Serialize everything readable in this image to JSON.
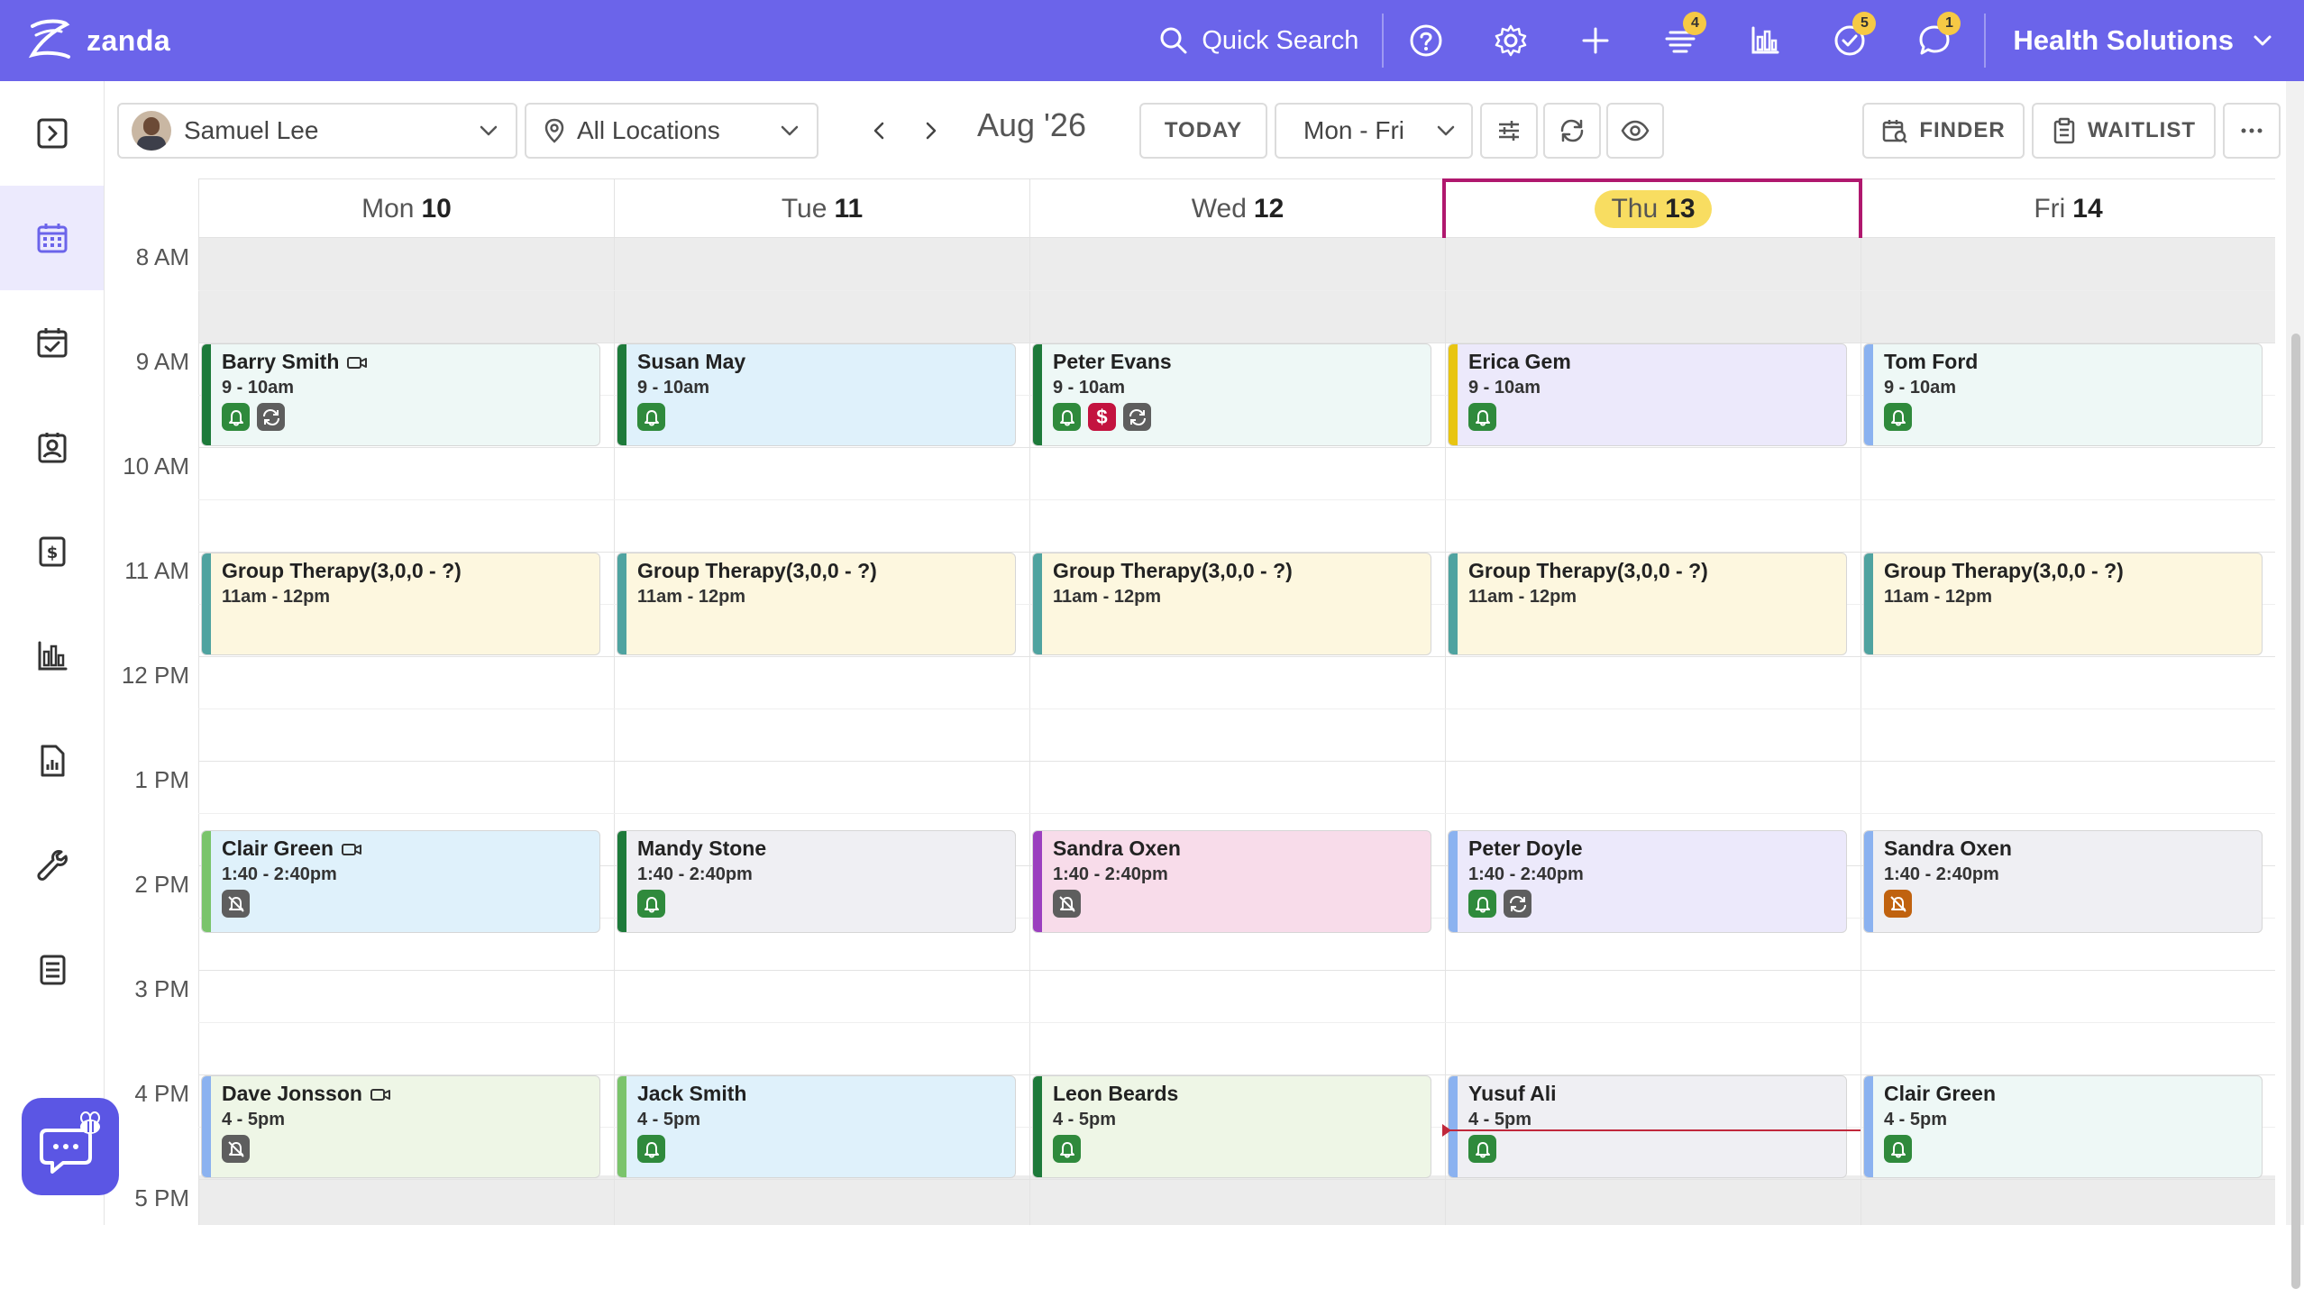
{
  "app": {
    "brand": "zanda",
    "quick_search": "Quick Search",
    "org": "Health Solutions",
    "badges": {
      "tasks": "4",
      "todo": "5",
      "messages": "1"
    }
  },
  "toolbar": {
    "practitioner": "Samuel Lee",
    "location": "All Locations",
    "month": "Aug '26",
    "today": "TODAY",
    "view": "Mon - Fri",
    "finder": "FINDER",
    "waitlist": "WAITLIST"
  },
  "days": [
    {
      "dow": "Mon",
      "num": "10"
    },
    {
      "dow": "Tue",
      "num": "11"
    },
    {
      "dow": "Wed",
      "num": "12"
    },
    {
      "dow": "Thu",
      "num": "13"
    },
    {
      "dow": "Fri",
      "num": "14"
    }
  ],
  "times": [
    "8 AM",
    "9 AM",
    "10 AM",
    "11 AM",
    "12 PM",
    "1 PM",
    "2 PM",
    "3 PM",
    "4 PM",
    "5 PM"
  ],
  "colors": {
    "brand": "#6b64ea",
    "green": "#2f8a3c",
    "teal": "#4fa3a0",
    "yellow": "#e8c511",
    "light_blue": "#8bb2f0",
    "purple": "#9b3fbf",
    "light_green": "#7ac46b",
    "dark_green": "#1d7a3a",
    "now": "#c0283b"
  },
  "appointments": [
    {
      "day": 0,
      "slot": "9",
      "name": "Barry Smith",
      "time": "9 - 10am",
      "video": true,
      "icons": [
        "bell",
        "repeat"
      ],
      "bg": "#eef8f6",
      "bar": "#1d7a3a"
    },
    {
      "day": 1,
      "slot": "9",
      "name": "Susan May",
      "time": "9 - 10am",
      "video": false,
      "icons": [
        "bell"
      ],
      "bg": "#dff1fb",
      "bar": "#1d7a3a"
    },
    {
      "day": 2,
      "slot": "9",
      "name": "Peter Evans",
      "time": "9 - 10am",
      "video": false,
      "icons": [
        "bell",
        "dollar",
        "repeat"
      ],
      "bg": "#eef8f6",
      "bar": "#1d7a3a"
    },
    {
      "day": 3,
      "slot": "9",
      "name": "Erica Gem",
      "time": "9 - 10am",
      "video": false,
      "icons": [
        "bell"
      ],
      "bg": "#ece9fb",
      "bar": "#e8c511"
    },
    {
      "day": 4,
      "slot": "9",
      "name": "Tom Ford",
      "time": "9 - 10am",
      "video": false,
      "icons": [
        "bell"
      ],
      "bg": "#eef8f6",
      "bar": "#8bb2f0"
    },
    {
      "day": 0,
      "slot": "11",
      "name": "Group Therapy(3,0,0 - ?)",
      "time": "11am - 12pm",
      "video": false,
      "icons": [],
      "bg": "#fdf7df",
      "bar": "#4fa3a0"
    },
    {
      "day": 1,
      "slot": "11",
      "name": "Group Therapy(3,0,0 - ?)",
      "time": "11am - 12pm",
      "video": false,
      "icons": [],
      "bg": "#fdf7df",
      "bar": "#4fa3a0"
    },
    {
      "day": 2,
      "slot": "11",
      "name": "Group Therapy(3,0,0 - ?)",
      "time": "11am - 12pm",
      "video": false,
      "icons": [],
      "bg": "#fdf7df",
      "bar": "#4fa3a0"
    },
    {
      "day": 3,
      "slot": "11",
      "name": "Group Therapy(3,0,0 - ?)",
      "time": "11am - 12pm",
      "video": false,
      "icons": [],
      "bg": "#fdf7df",
      "bar": "#4fa3a0"
    },
    {
      "day": 4,
      "slot": "11",
      "name": "Group Therapy(3,0,0 - ?)",
      "time": "11am - 12pm",
      "video": false,
      "icons": [],
      "bg": "#fdf7df",
      "bar": "#4fa3a0"
    },
    {
      "day": 0,
      "slot": "1:40",
      "name": "Clair Green",
      "time": "1:40 - 2:40pm",
      "video": true,
      "icons": [
        "bell-off"
      ],
      "bg": "#dff1fb",
      "bar": "#7ac46b"
    },
    {
      "day": 1,
      "slot": "1:40",
      "name": "Mandy Stone",
      "time": "1:40 - 2:40pm",
      "video": false,
      "icons": [
        "bell"
      ],
      "bg": "#efeff3",
      "bar": "#1d7a3a"
    },
    {
      "day": 2,
      "slot": "1:40",
      "name": "Sandra Oxen",
      "time": "1:40 - 2:40pm",
      "video": false,
      "icons": [
        "bell-off"
      ],
      "bg": "#f8dcea",
      "bar": "#9b3fbf"
    },
    {
      "day": 3,
      "slot": "1:40",
      "name": "Peter Doyle",
      "time": "1:40 - 2:40pm",
      "video": false,
      "icons": [
        "bell",
        "repeat"
      ],
      "bg": "#ece9fb",
      "bar": "#8bb2f0"
    },
    {
      "day": 4,
      "slot": "1:40",
      "name": "Sandra Oxen",
      "time": "1:40 - 2:40pm",
      "video": false,
      "icons": [
        "bell-off-orange"
      ],
      "bg": "#efeff3",
      "bar": "#8bb2f0"
    },
    {
      "day": 0,
      "slot": "4",
      "name": "Dave Jonsson",
      "time": "4 - 5pm",
      "video": true,
      "icons": [
        "bell-off"
      ],
      "bg": "#eef6e6",
      "bar": "#8bb2f0"
    },
    {
      "day": 1,
      "slot": "4",
      "name": "Jack Smith",
      "time": "4 - 5pm",
      "video": false,
      "icons": [
        "bell"
      ],
      "bg": "#dff1fb",
      "bar": "#7ac46b"
    },
    {
      "day": 2,
      "slot": "4",
      "name": "Leon Beards",
      "time": "4 - 5pm",
      "video": false,
      "icons": [
        "bell"
      ],
      "bg": "#eef6e6",
      "bar": "#1d7a3a"
    },
    {
      "day": 3,
      "slot": "4",
      "name": "Yusuf Ali",
      "time": "4 - 5pm",
      "video": false,
      "icons": [
        "bell"
      ],
      "bg": "#efeff3",
      "bar": "#8bb2f0"
    },
    {
      "day": 4,
      "slot": "4",
      "name": "Clair Green",
      "time": "4 - 5pm",
      "video": false,
      "icons": [
        "bell"
      ],
      "bg": "#eef8f6",
      "bar": "#8bb2f0"
    }
  ]
}
